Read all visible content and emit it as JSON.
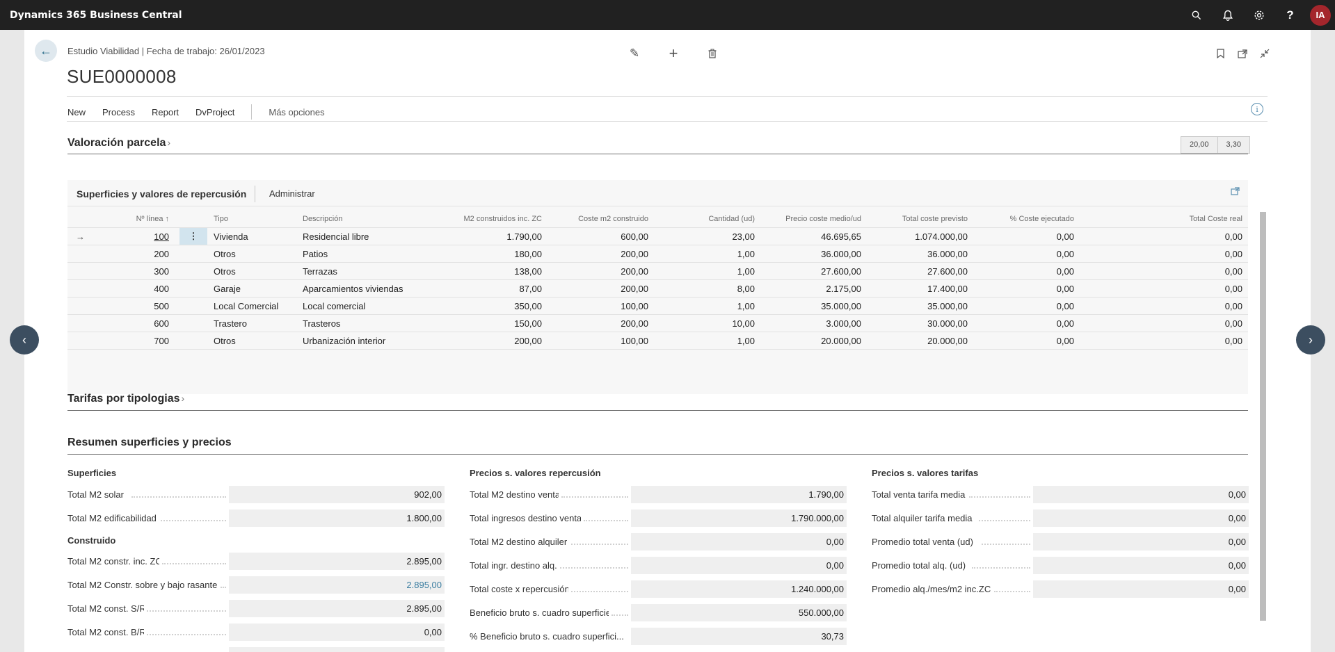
{
  "app": {
    "title": "Dynamics 365 Business Central",
    "avatar_initials": "IA",
    "icons": [
      "search-icon",
      "bell-icon",
      "gear-icon",
      "help-icon"
    ]
  },
  "header": {
    "caption": "Estudio Viabilidad | Fecha de trabajo: 26/01/2023",
    "title": "SUE0000008"
  },
  "actions": {
    "new": "New",
    "process": "Process",
    "report": "Report",
    "dvproject": "DvProject",
    "more": "Más opciones"
  },
  "valoracion": {
    "title": "Valoración parcela",
    "chevron": "›",
    "summary": [
      "20,00",
      "3,30"
    ]
  },
  "superficies": {
    "title": "Superficies y valores de repercusión",
    "admin": "Administrar",
    "columns": {
      "linea": "Nº línea ↑",
      "tipo": "Tipo",
      "descripcion": "Descripción",
      "m2": "M2 construidos inc. ZC",
      "coste_m2": "Coste m2 construido",
      "cantidad": "Cantidad (ud)",
      "precio": "Precio coste medio/ud",
      "total_prev": "Total coste previsto",
      "pct": "% Coste ejecutado",
      "total_real": "Total Coste real"
    },
    "rows": [
      {
        "linea": "100",
        "tipo": "Vivienda",
        "descripcion": "Residencial libre",
        "m2": "1.790,00",
        "coste_m2": "600,00",
        "cantidad": "23,00",
        "precio": "46.695,65",
        "total_prev": "1.074.000,00",
        "pct": "0,00",
        "total_real": "0,00"
      },
      {
        "linea": "200",
        "tipo": "Otros",
        "descripcion": "Patios",
        "m2": "180,00",
        "coste_m2": "200,00",
        "cantidad": "1,00",
        "precio": "36.000,00",
        "total_prev": "36.000,00",
        "pct": "0,00",
        "total_real": "0,00"
      },
      {
        "linea": "300",
        "tipo": "Otros",
        "descripcion": "Terrazas",
        "m2": "138,00",
        "coste_m2": "200,00",
        "cantidad": "1,00",
        "precio": "27.600,00",
        "total_prev": "27.600,00",
        "pct": "0,00",
        "total_real": "0,00"
      },
      {
        "linea": "400",
        "tipo": "Garaje",
        "descripcion": "Aparcamientos viviendas",
        "m2": "87,00",
        "coste_m2": "200,00",
        "cantidad": "8,00",
        "precio": "2.175,00",
        "total_prev": "17.400,00",
        "pct": "0,00",
        "total_real": "0,00"
      },
      {
        "linea": "500",
        "tipo": "Local Comercial",
        "descripcion": "Local comercial",
        "m2": "350,00",
        "coste_m2": "100,00",
        "cantidad": "1,00",
        "precio": "35.000,00",
        "total_prev": "35.000,00",
        "pct": "0,00",
        "total_real": "0,00"
      },
      {
        "linea": "600",
        "tipo": "Trastero",
        "descripcion": "Trasteros",
        "m2": "150,00",
        "coste_m2": "200,00",
        "cantidad": "10,00",
        "precio": "3.000,00",
        "total_prev": "30.000,00",
        "pct": "0,00",
        "total_real": "0,00"
      },
      {
        "linea": "700",
        "tipo": "Otros",
        "descripcion": "Urbanización interior",
        "m2": "200,00",
        "coste_m2": "100,00",
        "cantidad": "1,00",
        "precio": "20.000,00",
        "total_prev": "20.000,00",
        "pct": "0,00",
        "total_real": "0,00"
      }
    ]
  },
  "tarifas": {
    "title": "Tarifas por tipologias",
    "chevron": "›"
  },
  "resumen": {
    "title": "Resumen superficies y precios",
    "col1": {
      "group1": "Superficies",
      "group2": "Construido",
      "f1": {
        "label": "Total M2 solar",
        "value": "902,00"
      },
      "f2": {
        "label": "Total M2 edificabilidad",
        "value": "1.800,00"
      },
      "f3": {
        "label": "Total M2 constr. inc. ZC",
        "value": "2.895,00"
      },
      "f4": {
        "label": "Total M2 Constr. sobre y bajo rasante",
        "value": "2.895,00"
      },
      "f5": {
        "label": "Total M2 const. S/R",
        "value": "2.895,00"
      },
      "f6": {
        "label": "Total M2 const. B/R",
        "value": "0,00"
      }
    },
    "col2": {
      "group": "Precios s. valores repercusión",
      "f1": {
        "label": "Total M2 destino venta",
        "value": "1.790,00"
      },
      "f2": {
        "label": "Total ingresos destino venta",
        "value": "1.790.000,00"
      },
      "f3": {
        "label": "Total M2 destino alquiler",
        "value": "0,00"
      },
      "f4": {
        "label": "Total ingr. destino alq.",
        "value": "0,00"
      },
      "f5": {
        "label": "Total coste x repercusión",
        "value": "1.240.000,00"
      },
      "f6": {
        "label": "Beneficio bruto s. cuadro superficies",
        "value": "550.000,00"
      },
      "f7": {
        "label": "% Beneficio bruto s. cuadro superfici...",
        "value": "30,73"
      }
    },
    "col3": {
      "group": "Precios s. valores tarifas",
      "f1": {
        "label": "Total venta tarifa media",
        "value": "0,00"
      },
      "f2": {
        "label": "Total alquiler tarifa media",
        "value": "0,00"
      },
      "f3": {
        "label": "Promedio total venta (ud)",
        "value": "0,00"
      },
      "f4": {
        "label": "Promedio total alq. (ud)",
        "value": "0,00"
      },
      "f5": {
        "label": "Promedio alq./mes/m2 inc.ZC",
        "value": "0,00"
      }
    }
  }
}
